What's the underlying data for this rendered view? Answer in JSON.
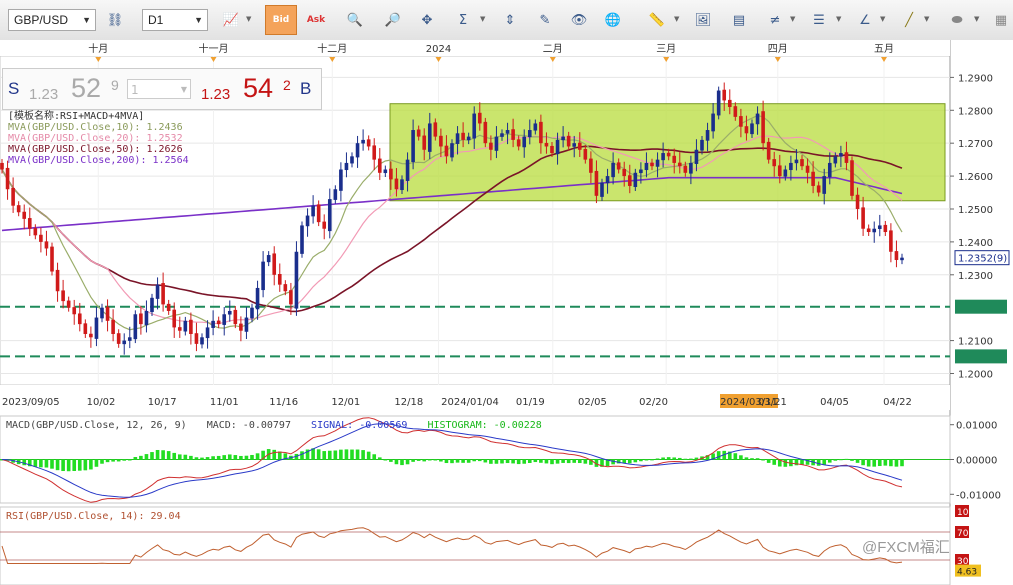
{
  "toolbar": {
    "symbol": "GBP/USD",
    "timeframe": "D1",
    "bid_label": "Bid",
    "ask_label": "Ask"
  },
  "quote": {
    "sell_label": "S",
    "sell_prefix": "1.23",
    "sell_big": "52",
    "sell_sup": "9",
    "lot_value": "1",
    "buy_prefix": "1.23",
    "buy_big": "54",
    "buy_sup": "2",
    "buy_label": "B"
  },
  "colors": {
    "up": "#1a2e8c",
    "down": "#d01a1a",
    "ma10": "#9aad6a",
    "ma20": "#f29ab5",
    "ma50": "#7a1428",
    "ma200": "#7a30c8",
    "zone": "#b8dc3c",
    "macd_hist": "#22dd22",
    "support": "#1f8a5a"
  },
  "main_indicators": {
    "template": "[模板名称:RSI+MACD+4MVA]",
    "ma10": "MVA(GBP/USD.Close,10): 1.2436",
    "ma20": "MVA(GBP/USD.Close,20): 1.2532",
    "ma50": "MVA(GBP/USD.Close,50): 1.2626",
    "ma200": "MVA(GBP/USD.Close,200): 1.2564"
  },
  "macd_panel": {
    "name": "MACD(GBP/USD.Close, 12, 26, 9)",
    "macd": "MACD: -0.00797",
    "signal": "SIGNAL: -0.00569",
    "histogram": "HISTOGRAM: -0.00228",
    "ticks": [
      "0.01000",
      "0.00000",
      "-0.01000"
    ]
  },
  "rsi_panel": {
    "name": "RSI(GBP/USD.Close, 14): 29.04",
    "ticks": [
      "100",
      "70",
      "30"
    ],
    "last_value": "4.63"
  },
  "watermark": "@FXCM福汇",
  "chart_data": {
    "type": "candlestick",
    "symbol": "GBP/USD",
    "timeframe": "D1",
    "month_labels": [
      "十月",
      "十一月",
      "十二月",
      "2024",
      "二月",
      "三月",
      "四月",
      "五月"
    ],
    "date_labels": [
      "2023/09/05",
      "10/02",
      "10/17",
      "11/01",
      "11/16",
      "12/01",
      "12/18",
      "2024/01/04",
      "01/19",
      "02/05",
      "02/20",
      "2024/03/11",
      "03/21",
      "04/05",
      "04/22"
    ],
    "y_ticks": [
      "1.2900",
      "1.2800",
      "1.2700",
      "1.2600",
      "1.2500",
      "1.2400",
      "1.2300",
      "1.2100",
      "1.2000"
    ],
    "ylim": [
      1.1965,
      1.2965
    ],
    "current_price": "1.2352(9)",
    "support_levels": [
      1.2203,
      1.2052
    ],
    "range_zone": [
      1.2525,
      1.282
    ],
    "close": [
      1.262,
      1.256,
      1.251,
      1.249,
      1.247,
      1.244,
      1.242,
      1.24,
      1.238,
      1.231,
      1.225,
      1.222,
      1.22,
      1.218,
      1.215,
      1.212,
      1.211,
      1.217,
      1.22,
      1.216,
      1.212,
      1.209,
      1.21,
      1.211,
      1.218,
      1.215,
      1.219,
      1.223,
      1.227,
      1.221,
      1.219,
      1.214,
      1.213,
      1.216,
      1.212,
      1.209,
      1.211,
      1.214,
      1.216,
      1.215,
      1.218,
      1.219,
      1.215,
      1.213,
      1.217,
      1.22,
      1.226,
      1.234,
      1.236,
      1.23,
      1.227,
      1.225,
      1.221,
      1.237,
      1.245,
      1.248,
      1.251,
      1.246,
      1.244,
      1.253,
      1.256,
      1.262,
      1.264,
      1.266,
      1.27,
      1.271,
      1.269,
      1.265,
      1.261,
      1.262,
      1.259,
      1.256,
      1.259,
      1.265,
      1.274,
      1.272,
      1.268,
      1.276,
      1.272,
      1.269,
      1.266,
      1.27,
      1.273,
      1.271,
      1.272,
      1.279,
      1.276,
      1.27,
      1.268,
      1.272,
      1.273,
      1.274,
      1.271,
      1.269,
      1.272,
      1.274,
      1.276,
      1.27,
      1.269,
      1.267,
      1.271,
      1.272,
      1.269,
      1.27,
      1.268,
      1.265,
      1.261,
      1.254,
      1.258,
      1.26,
      1.264,
      1.262,
      1.26,
      1.257,
      1.261,
      1.262,
      1.264,
      1.263,
      1.265,
      1.267,
      1.266,
      1.264,
      1.263,
      1.261,
      1.264,
      1.268,
      1.271,
      1.274,
      1.279,
      1.286,
      1.283,
      1.281,
      1.278,
      1.275,
      1.273,
      1.276,
      1.279,
      1.27,
      1.265,
      1.263,
      1.26,
      1.262,
      1.264,
      1.265,
      1.263,
      1.261,
      1.257,
      1.255,
      1.26,
      1.264,
      1.266,
      1.267,
      1.264,
      1.254,
      1.25,
      1.244,
      1.243,
      1.244,
      1.245,
      1.243,
      1.237,
      1.2345,
      1.2352
    ]
  }
}
